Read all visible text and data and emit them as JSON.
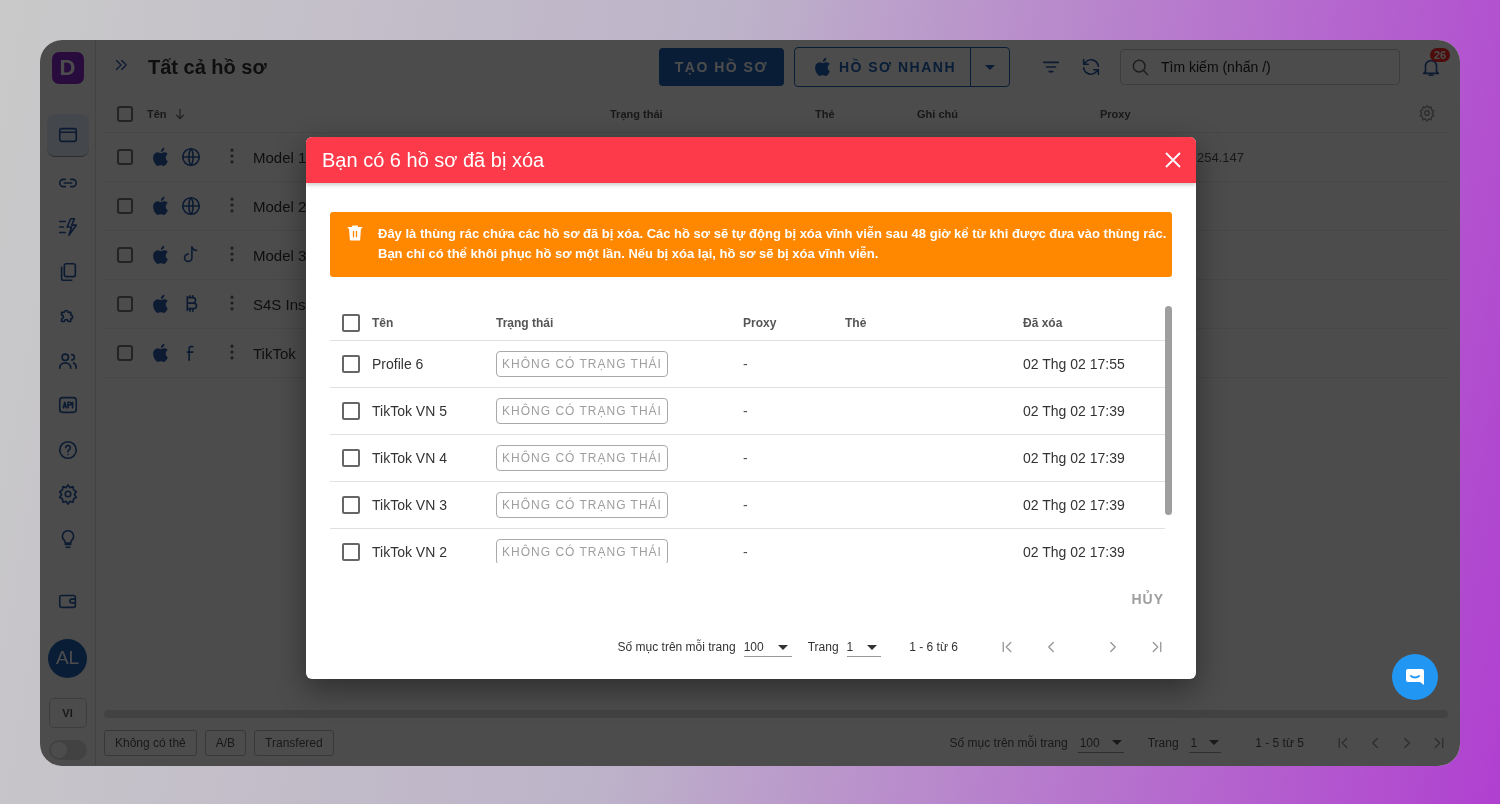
{
  "app": {
    "logo": "D",
    "title": "Tất cả hồ sơ",
    "create_button": "TẠO HỒ SƠ",
    "quick_button": "HỒ SƠ NHANH",
    "search": {
      "placeholder": "Tìm kiếm (nhấn /)"
    },
    "notifications": "26",
    "sidebar": {
      "items": [
        {
          "selected": true
        },
        {
          "selected": false
        },
        {
          "selected": false
        },
        {
          "selected": false
        },
        {
          "selected": false
        },
        {
          "selected": false
        },
        {
          "selected": false
        },
        {
          "selected": false
        },
        {
          "selected": false
        },
        {
          "selected": false
        },
        {
          "selected": false
        }
      ]
    },
    "select_all_checked": false,
    "avatar": "AL",
    "language": "VI",
    "theme_toggle": {
      "on": false
    },
    "columns": [
      "Tên",
      "Trạng thái",
      "Thẻ",
      "Ghi chú",
      "Proxy"
    ],
    "rows": [
      {
        "name": "Model 1",
        "proxy": "254.147",
        "checked": false
      },
      {
        "name": "Model 2",
        "checked": false
      },
      {
        "name": "Model 3",
        "checked": false
      },
      {
        "name": "S4S Ins",
        "checked": false
      },
      {
        "name": "TikTok",
        "checked": false
      }
    ],
    "tags": [
      "Không có thẻ",
      "A/B",
      "Transfered"
    ],
    "pagination": {
      "per_page_label": "Số mục trên mỗi trang",
      "per_page": "100",
      "page_label": "Trang",
      "page": "1",
      "range": "1 - 5 từ 5"
    }
  },
  "dialog": {
    "title": "Bạn có 6 hồ sơ đã bị xóa",
    "alert": [
      "Đây là thùng rác chứa các hồ sơ đã bị xóa. Các hồ sơ sẽ tự động bị xóa vĩnh viễn sau 48 giờ kể từ khi được đưa vào thùng rác.",
      "Bạn chỉ có thể khôi phục hồ sơ một lần. Nếu bị xóa lại, hồ sơ sẽ bị xóa vĩnh viễn."
    ],
    "select_all_checked": false,
    "columns": [
      "Tên",
      "Trạng thái",
      "Proxy",
      "Thẻ",
      "Đã xóa"
    ],
    "rows": [
      {
        "name": "Profile 6",
        "status": "KHÔNG CÓ TRẠNG THÁI",
        "proxy": "-",
        "deleted": "02 Thg 02 17:55",
        "checked": false
      },
      {
        "name": "TikTok VN 5",
        "status": "KHÔNG CÓ TRẠNG THÁI",
        "proxy": "-",
        "deleted": "02 Thg 02 17:39",
        "checked": false
      },
      {
        "name": "TikTok VN 4",
        "status": "KHÔNG CÓ TRẠNG THÁI",
        "proxy": "-",
        "deleted": "02 Thg 02 17:39",
        "checked": false
      },
      {
        "name": "TikTok VN 3",
        "status": "KHÔNG CÓ TRẠNG THÁI",
        "proxy": "-",
        "deleted": "02 Thg 02 17:39",
        "checked": false
      },
      {
        "name": "TikTok VN 2",
        "status": "KHÔNG CÓ TRẠNG THÁI",
        "proxy": "-",
        "deleted": "02 Thg 02 17:39",
        "checked": false
      }
    ],
    "cancel_button": "HỦY",
    "pagination": {
      "per_page_label": "Số mục trên mỗi trang",
      "per_page": "100",
      "page_label": "Trang",
      "page": "1",
      "range": "1 - 6 từ 6"
    }
  }
}
